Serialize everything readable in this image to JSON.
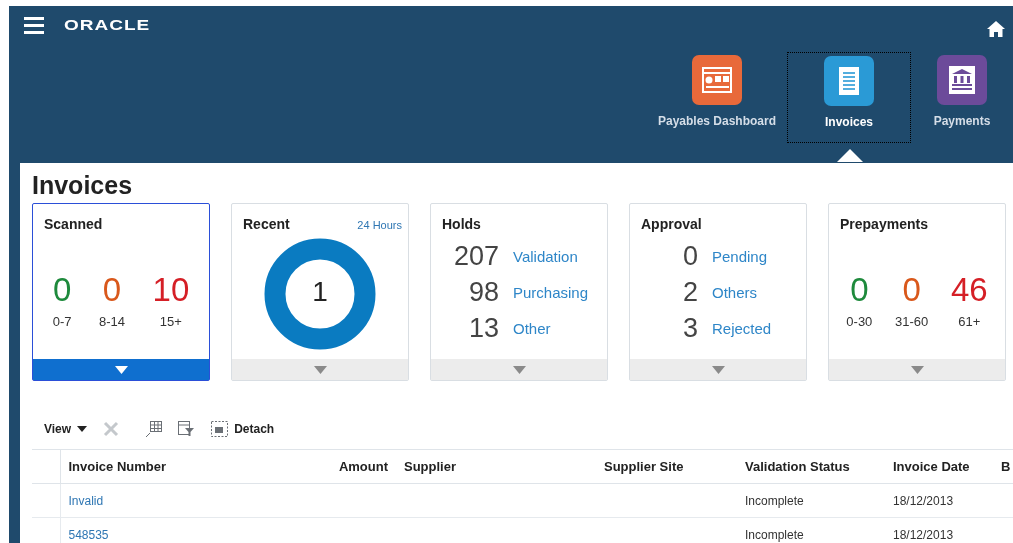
{
  "header": {
    "logo": "ORACLE"
  },
  "nav": [
    {
      "label": "Payables Dashboard",
      "kind": "dashboard",
      "selected": false
    },
    {
      "label": "Invoices",
      "kind": "invoices",
      "selected": true
    },
    {
      "label": "Payments",
      "kind": "payments",
      "selected": false
    }
  ],
  "page_title": "Invoices",
  "tiles": [
    {
      "title": "Scanned",
      "kind": "aging",
      "selected": true,
      "buckets": [
        {
          "value": "0",
          "label": "0-7",
          "color": "#1e8a3c"
        },
        {
          "value": "0",
          "label": "8-14",
          "color": "#d9581b"
        },
        {
          "value": "10",
          "label": "15+",
          "color": "#d51f26"
        }
      ]
    },
    {
      "title": "Recent",
      "kind": "donut",
      "selected": false,
      "period": "24 Hours",
      "value": "1"
    },
    {
      "title": "Holds",
      "kind": "list",
      "selected": false,
      "entries": [
        {
          "count": "207",
          "label": "Validation"
        },
        {
          "count": "98",
          "label": "Purchasing"
        },
        {
          "count": "13",
          "label": "Other"
        }
      ]
    },
    {
      "title": "Approval",
      "kind": "list",
      "selected": false,
      "entries": [
        {
          "count": "0",
          "label": "Pending"
        },
        {
          "count": "2",
          "label": "Others"
        },
        {
          "count": "3",
          "label": "Rejected"
        }
      ]
    },
    {
      "title": "Prepayments",
      "kind": "aging",
      "selected": false,
      "buckets": [
        {
          "value": "0",
          "label": "0-30",
          "color": "#1e8a3c"
        },
        {
          "value": "0",
          "label": "31-60",
          "color": "#d9581b"
        },
        {
          "value": "46",
          "label": "61+",
          "color": "#d51f26"
        }
      ]
    }
  ],
  "toolbar": {
    "view": "View",
    "actions": [
      {
        "kind": "delete",
        "disabled": true
      },
      {
        "kind": "freeze",
        "disabled": false
      },
      {
        "kind": "filter",
        "disabled": false
      },
      {
        "kind": "detach",
        "label": "Detach",
        "disabled": false
      }
    ]
  },
  "table": {
    "columns": [
      "Invoice Number",
      "Amount",
      "Supplier",
      "Supplier Site",
      "Validation Status",
      "Invoice Date",
      "B"
    ],
    "rows": [
      {
        "cells": [
          "Invalid",
          null,
          null,
          null,
          "Incomplete",
          "18/12/2013",
          null
        ]
      },
      {
        "cells": [
          "548535",
          null,
          null,
          null,
          "Incomplete",
          "18/12/2013",
          null
        ]
      }
    ]
  }
}
